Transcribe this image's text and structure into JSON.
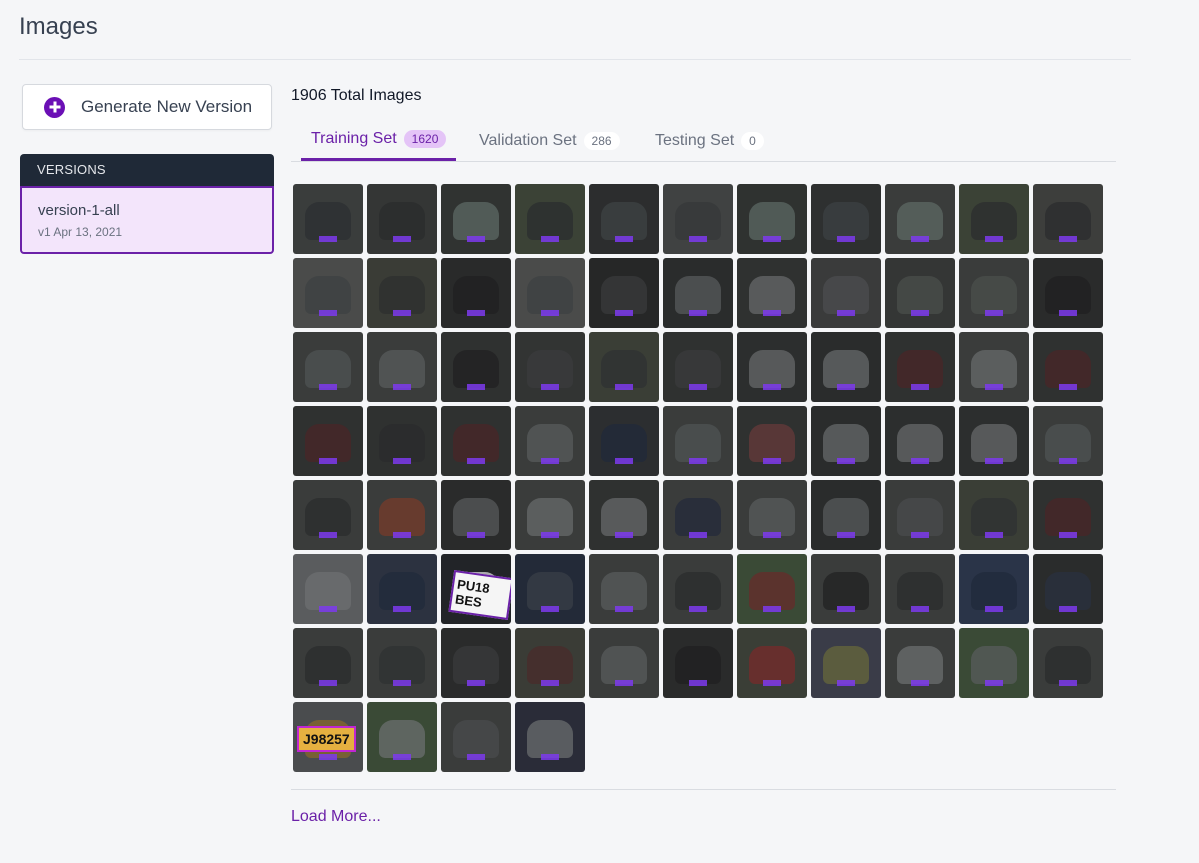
{
  "page": {
    "title": "Images"
  },
  "sidebar": {
    "generate_button_label": "Generate New Version",
    "versions_header": "VERSIONS",
    "version": {
      "name": "version-1-all",
      "date": "v1 Apr 13, 2021"
    }
  },
  "main": {
    "total_images": "1906 Total Images",
    "tabs": [
      {
        "label": "Training Set",
        "count": "1620",
        "active": true
      },
      {
        "label": "Validation Set",
        "count": "286",
        "active": false
      },
      {
        "label": "Testing Set",
        "count": "0",
        "active": false
      }
    ],
    "load_more": "Load More...",
    "visible_plate_texts": [
      "PU18 BES",
      "J98257"
    ]
  },
  "thumbnails": [
    {
      "bg": "#3a3d3c",
      "car": "#2b2d30"
    },
    {
      "bg": "#343635",
      "car": "#2a2b2c"
    },
    {
      "bg": "#303331",
      "car": "#5f6c68"
    },
    {
      "bg": "#3b4236",
      "car": "#2a2c2e"
    },
    {
      "bg": "#2c2d2e",
      "car": "#3f4446"
    },
    {
      "bg": "#404242",
      "car": "#353839"
    },
    {
      "bg": "#2f3230",
      "car": "#5e6b67"
    },
    {
      "bg": "#2e3030",
      "car": "#3d4244"
    },
    {
      "bg": "#3a3c3b",
      "car": "#5f6b67"
    },
    {
      "bg": "#3b4236",
      "car": "#2b2c2e"
    },
    {
      "bg": "#3d3e3c",
      "car": "#2a2b2c"
    },
    {
      "bg": "#4a4b4a",
      "car": "#3c4042"
    },
    {
      "bg": "#3a3c36",
      "car": "#2c2d2e"
    },
    {
      "bg": "#292a2a",
      "car": "#1f2021"
    },
    {
      "bg": "#4a4b4a",
      "car": "#3c4042"
    },
    {
      "bg": "#262727",
      "car": "#3a3c3d"
    },
    {
      "bg": "#2a2c2c",
      "car": "#5a5c5e"
    },
    {
      "bg": "#2f3130",
      "car": "#6a6c6e"
    },
    {
      "bg": "#3a3b3b",
      "car": "#4d4f51"
    },
    {
      "bg": "#343635",
      "car": "#4b504d"
    },
    {
      "bg": "#3a3c3b",
      "car": "#4b504d"
    },
    {
      "bg": "#2a2b2b",
      "car": "#1f2021"
    },
    {
      "bg": "#3a3c3b",
      "car": "#505455"
    },
    {
      "bg": "#3a3c3b",
      "car": "#5a5c5e"
    },
    {
      "bg": "#2f3130",
      "car": "#1f2021"
    },
    {
      "bg": "#323433",
      "car": "#3a3c3d"
    },
    {
      "bg": "#3a3e36",
      "car": "#2e3032"
    },
    {
      "bg": "#2f3130",
      "car": "#3a3c3d"
    },
    {
      "bg": "#2c2e2e",
      "car": "#6a6c6e"
    },
    {
      "bg": "#2a2c2c",
      "car": "#6a6c6e"
    },
    {
      "bg": "#2f3130",
      "car": "#4a2526"
    },
    {
      "bg": "#3a3c3b",
      "car": "#6a6c6e"
    },
    {
      "bg": "#2f3130",
      "car": "#4a2526"
    },
    {
      "bg": "#2f3130",
      "car": "#4a2526"
    },
    {
      "bg": "#2f3130",
      "car": "#2a2b2c"
    },
    {
      "bg": "#2f3130",
      "car": "#4a2526"
    },
    {
      "bg": "#3a3c3b",
      "car": "#5a5c5e"
    },
    {
      "bg": "#2c2e30",
      "car": "#1f2a3a"
    },
    {
      "bg": "#3a3c3b",
      "car": "#505455"
    },
    {
      "bg": "#2f3130",
      "car": "#6a3a3a"
    },
    {
      "bg": "#2a2c2c",
      "car": "#6a6c6e"
    },
    {
      "bg": "#2c2e2e",
      "car": "#6a6c6e"
    },
    {
      "bg": "#2c2e2e",
      "car": "#6a6c6e"
    },
    {
      "bg": "#3a3c3b",
      "car": "#505455"
    },
    {
      "bg": "#3a3c3b",
      "car": "#2a2b2c"
    },
    {
      "bg": "#3a3c3b",
      "car": "#7a3a2a"
    },
    {
      "bg": "#2a2b2b",
      "car": "#5a5c5e"
    },
    {
      "bg": "#3a3c3b",
      "car": "#6a6c6e"
    },
    {
      "bg": "#2f3130",
      "car": "#6a6c6e"
    },
    {
      "bg": "#3a3c3b",
      "car": "#22283a"
    },
    {
      "bg": "#3a3c3b",
      "car": "#5a5c5e"
    },
    {
      "bg": "#2a2c2c",
      "car": "#5a5c5e"
    },
    {
      "bg": "#3a3c3b",
      "car": "#4a4c4e"
    },
    {
      "bg": "#3a3e36",
      "car": "#2e3032"
    },
    {
      "bg": "#2f3130",
      "car": "#4a2526"
    },
    {
      "bg": "#5a5c5e",
      "car": "#6e7072"
    },
    {
      "bg": "#2c3240",
      "car": "#1f2a3a"
    },
    {
      "bg": "#222428",
      "car": "#e5e5e5"
    },
    {
      "bg": "#232a38",
      "car": "#3a4048"
    },
    {
      "bg": "#3a3c3b",
      "car": "#5a5c5e"
    },
    {
      "bg": "#3a3c3b",
      "car": "#2a2b2c"
    },
    {
      "bg": "#3a4a36",
      "car": "#6a2a2a"
    },
    {
      "bg": "#3a3c3b",
      "car": "#1f2021"
    },
    {
      "bg": "#3a3c3b",
      "car": "#2a2b2c"
    },
    {
      "bg": "#2a3448",
      "car": "#1f2a3a"
    },
    {
      "bg": "#2a2c2c",
      "car": "#2a3040"
    },
    {
      "bg": "#3a3c3b",
      "car": "#2a2b2c"
    },
    {
      "bg": "#3a3c3b",
      "car": "#2e3032"
    },
    {
      "bg": "#2a2b2b",
      "car": "#3a3c3d"
    },
    {
      "bg": "#3a3c36",
      "car": "#4a2a2a"
    },
    {
      "bg": "#3a3c3b",
      "car": "#5a5c5e"
    },
    {
      "bg": "#2a2b2b",
      "car": "#1f2021"
    },
    {
      "bg": "#3a3e36",
      "car": "#7a2a2a"
    },
    {
      "bg": "#3a3c48",
      "car": "#6a6a3a"
    },
    {
      "bg": "#3a3c3b",
      "car": "#6e7072"
    },
    {
      "bg": "#3a4a36",
      "car": "#5a5c5e"
    },
    {
      "bg": "#3a3c3b",
      "car": "#2a2b2c"
    },
    {
      "bg": "#4a4c4e",
      "car": "#8a6a2a"
    },
    {
      "bg": "#3a4a36",
      "car": "#6e7072"
    },
    {
      "bg": "#3a3c3b",
      "car": "#4a4c4e"
    },
    {
      "bg": "#2a2c38",
      "car": "#6e7072"
    }
  ]
}
